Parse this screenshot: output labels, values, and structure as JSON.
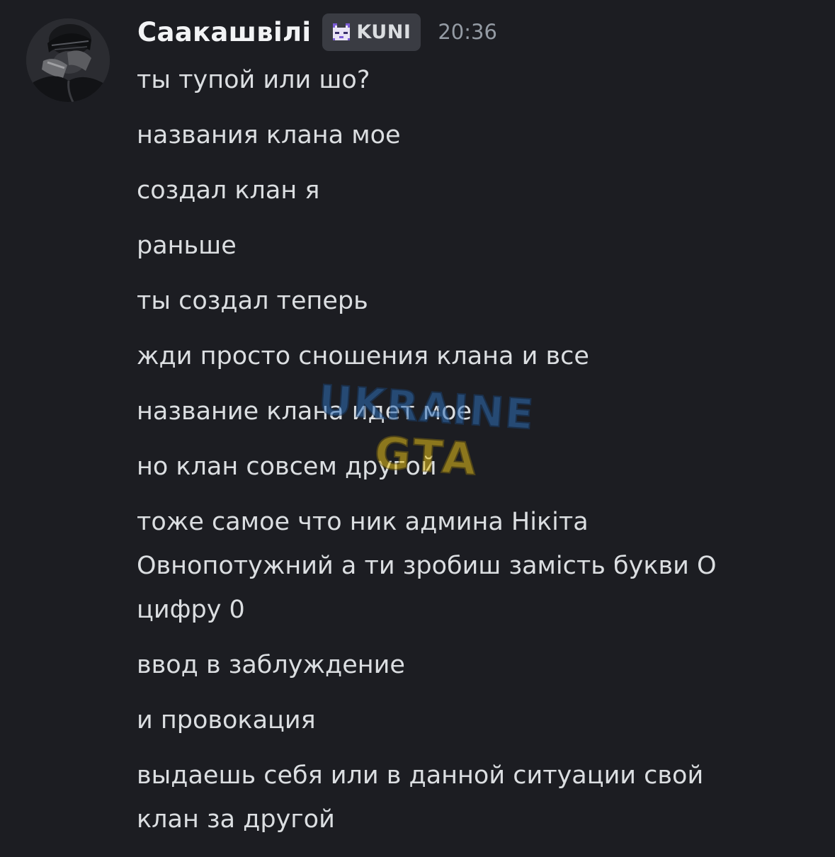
{
  "message": {
    "username": "Саакашвілі",
    "tag": {
      "text": "KUNI",
      "icon": "pixel-cat-icon",
      "icon_colors": {
        "body": "#e9e4f5",
        "accent": "#7b5cd6"
      }
    },
    "timestamp": "20:36",
    "lines": [
      "ты тупой или шо?",
      "названия клана мое",
      "создал клан я",
      "раньше",
      "ты создал теперь",
      "жди просто сношения клана и все",
      "название клана идет мое",
      "но клан совсем другой",
      "тоже самое что ник админа Нікіта",
      "Овнопотужний а ти зробиш замість букви О",
      "цифру 0",
      "ввод в заблуждение",
      "и провокация",
      "выдаешь себя или в данной ситуации свой",
      "клан за другой"
    ]
  },
  "watermark": {
    "line1": "UKRAINE",
    "line2": "GTA",
    "colors": {
      "top": "#2f6fb8",
      "bottom": "#e8c21a"
    }
  },
  "colors": {
    "background": "#1c1d22",
    "text": "#dbdee1",
    "username": "#f2f3f5",
    "timestamp": "#949ba4",
    "tag_background": "#3a3c43"
  }
}
